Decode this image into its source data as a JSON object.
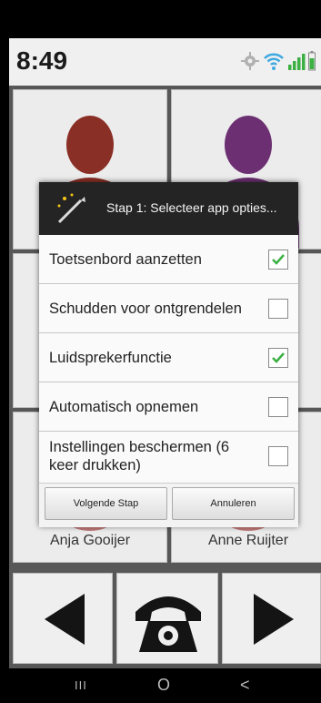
{
  "status_bar": {
    "time": "8:49",
    "icons": [
      "settings-icon",
      "wifi-icon",
      "signal-icon",
      "battery-icon"
    ]
  },
  "contacts": [
    {
      "name": "",
      "avatar_color": "#8a2f26"
    },
    {
      "name": "",
      "avatar_color": "#6c2f72"
    },
    {
      "name": "Anja Gooijer",
      "avatar_color": "#c07878"
    },
    {
      "name": "Anne Ruijter",
      "avatar_color": "#c07878"
    }
  ],
  "dialog": {
    "title": "Stap 1: Selecteer app opties...",
    "options": [
      {
        "label": "Toetsenbord aanzetten",
        "checked": true
      },
      {
        "label": "Schudden voor ontgrendelen",
        "checked": false
      },
      {
        "label": "Luidsprekerfunctie",
        "checked": true
      },
      {
        "label": "Automatisch opnemen",
        "checked": false
      },
      {
        "label": "Instellingen beschermen (6 keer drukken)",
        "checked": false
      }
    ],
    "next_button": "Volgende Stap",
    "cancel_button": "Annuleren"
  },
  "bottom_nav": {
    "icons": [
      "previous-arrow-icon",
      "phone-icon",
      "next-arrow-icon"
    ]
  },
  "system_nav": {
    "recents": "III",
    "home": "O",
    "back": "<"
  },
  "colors": {
    "check_green": "#3cb043",
    "dialog_header": "#242424",
    "background": "#575757"
  }
}
